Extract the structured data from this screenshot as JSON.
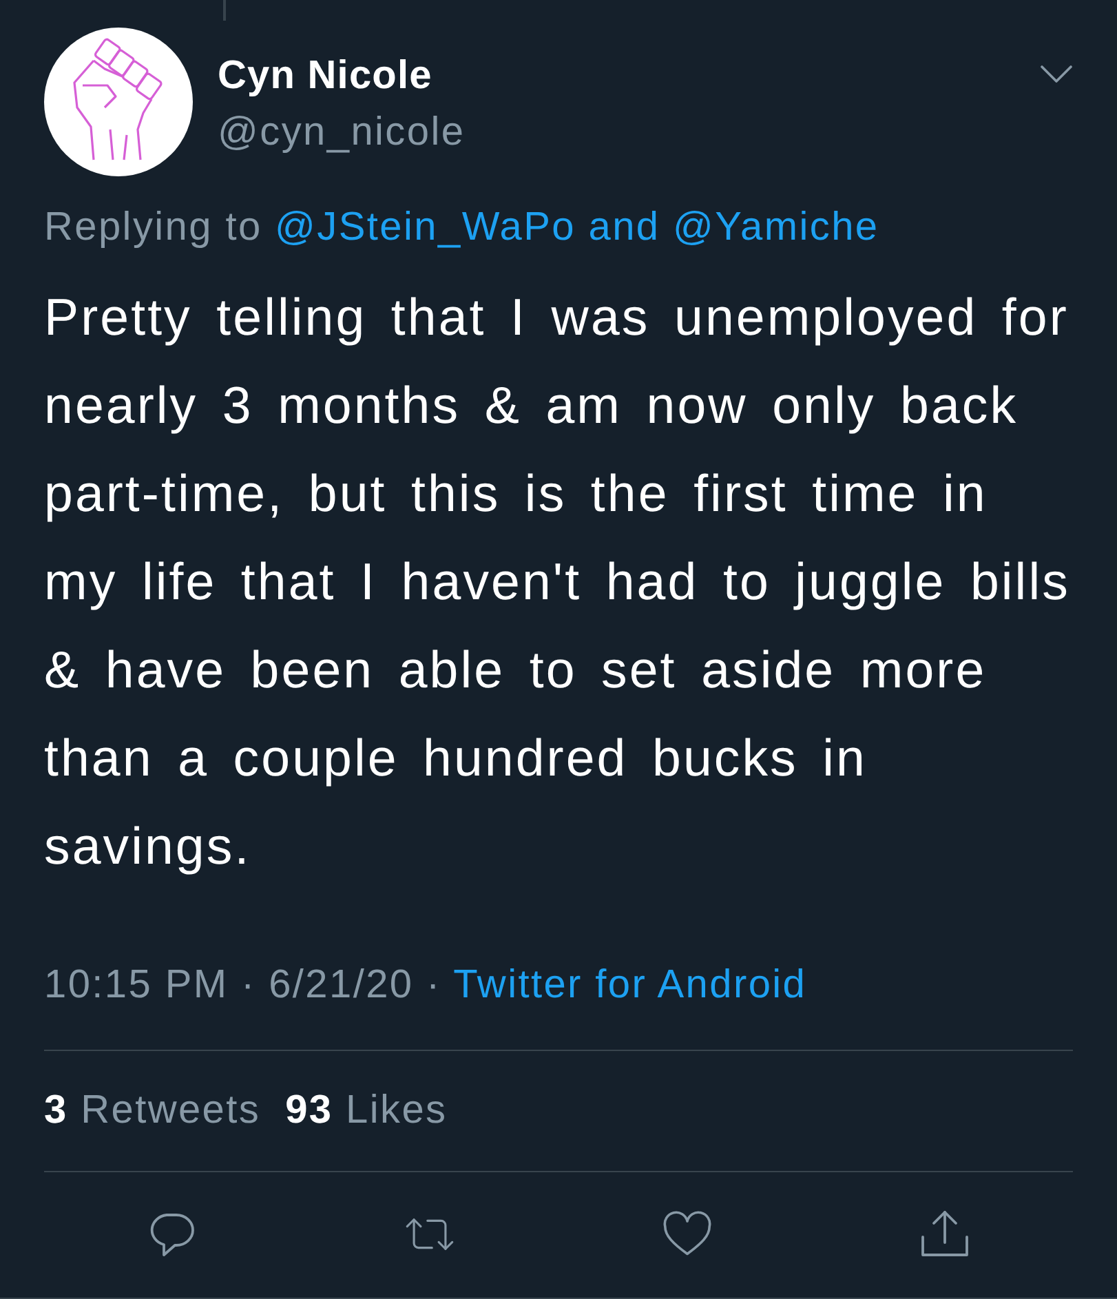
{
  "tweet": {
    "author": {
      "name": "Cyn Nicole",
      "handle": "@cyn_nicole"
    },
    "reply_context": {
      "label": "Replying to",
      "mentions": "@JStein_WaPo and @Yamiche"
    },
    "text": "Pretty telling that I was unemployed for nearly 3 months & am now only back part-time, but this is the first time in my life that I haven't had to juggle bills & have been able to set aside more than a couple hundred bucks in savings.",
    "meta": {
      "timestamp": "10:15 PM · 6/21/20 ·",
      "source": "Twitter for Android"
    },
    "stats": [
      {
        "count": "3",
        "label": "Retweets"
      },
      {
        "count": "93",
        "label": "Likes"
      }
    ]
  }
}
